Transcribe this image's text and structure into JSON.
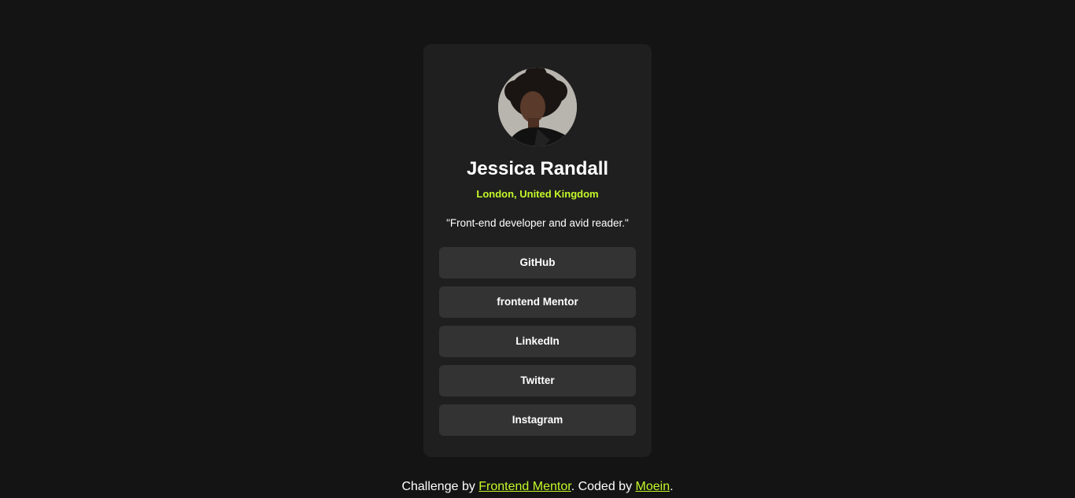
{
  "profile": {
    "avatar_icon": "profile-photo",
    "name": "Jessica Randall",
    "location": "London, United Kingdom",
    "bio": "\"Front-end developer and avid reader.\""
  },
  "links": [
    {
      "label": "GitHub"
    },
    {
      "label": "frontend Mentor"
    },
    {
      "label": "LinkedIn"
    },
    {
      "label": "Twitter"
    },
    {
      "label": "Instagram"
    }
  ],
  "footer": {
    "prefix": "Challenge by ",
    "challenge_link": "Frontend Mentor",
    "middle": ". Coded by ",
    "author_link": "Moein",
    "suffix": "."
  },
  "colors": {
    "background": "#141414",
    "card": "#1f1f1f",
    "button": "#333333",
    "accent": "#c4f82a",
    "text": "#ffffff"
  }
}
